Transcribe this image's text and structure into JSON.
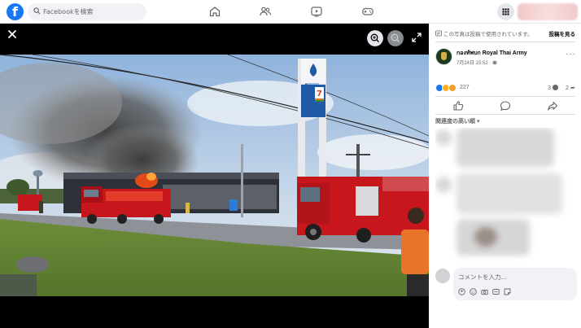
{
  "topbar": {
    "logo": "f",
    "search_placeholder": "Facebookを検索",
    "nav_icons": [
      "home-icon",
      "friends-icon",
      "watch-icon",
      "gaming-icon"
    ],
    "menu_icon": "grid-menu-icon"
  },
  "viewer": {
    "close_icon": "close-icon",
    "zoom_in_icon": "zoom-in-icon",
    "zoom_out_icon": "zoom-out-icon",
    "fullscreen_icon": "fullscreen-icon",
    "photo_sign_text": "7"
  },
  "panel": {
    "notice_text": "この写真は投稿で使用されています。",
    "notice_link": "投稿を見る",
    "page_name": "กองทัพบก Royal Thai Army",
    "post_time": "7月24日 15:52 · ",
    "more_label": "···",
    "reaction_count": "227",
    "comment_count": "3",
    "share_count": "2",
    "reaction_types": [
      "like",
      "care",
      "sad"
    ],
    "actions": [
      "like-icon",
      "comment-icon",
      "share-icon"
    ],
    "sort_label": "関連度の高い順 ▾",
    "comment_placeholder": "コメントを入力...",
    "comment_tools": [
      "avatar-sticker-icon",
      "emoji-icon",
      "camera-icon",
      "gif-icon",
      "sticker-icon"
    ],
    "send_icon": "send-icon"
  },
  "colors": {
    "brand": "#1877f2",
    "fire_truck": "#c8161d",
    "station_blue": "#1f5aa6"
  }
}
